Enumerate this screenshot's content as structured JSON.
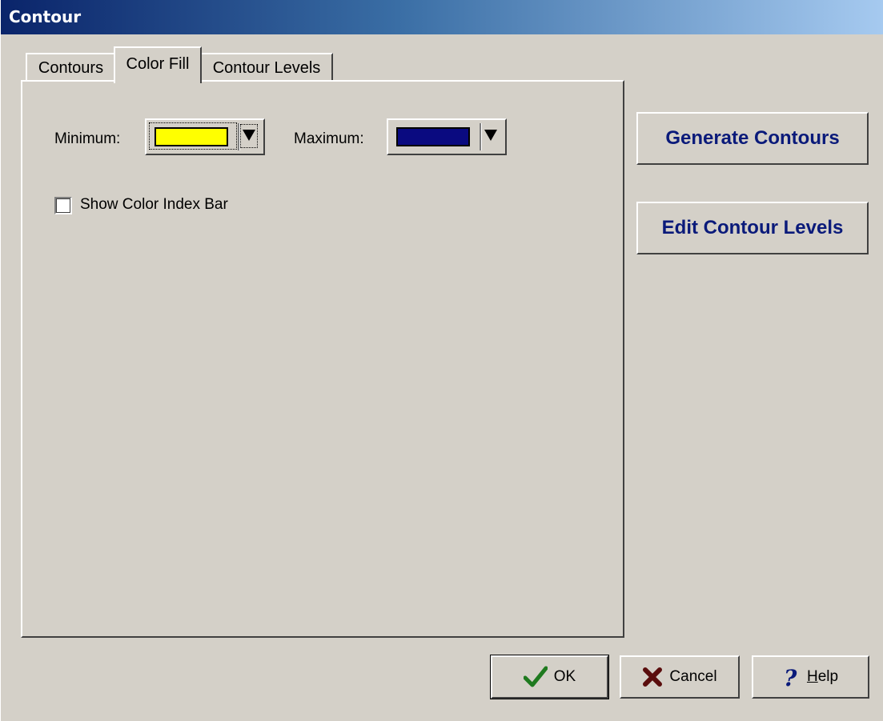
{
  "window": {
    "title": "Contour"
  },
  "tabs": [
    {
      "label": "Contours",
      "active": false
    },
    {
      "label": "Color Fill",
      "active": true
    },
    {
      "label": "Contour Levels",
      "active": false
    }
  ],
  "color_fill": {
    "minimum_label": "Minimum:",
    "minimum_color": "#ffff00",
    "maximum_label": "Maximum:",
    "maximum_color": "#0a0a80",
    "show_index_bar_label": "Show Color Index Bar",
    "show_index_bar_checked": false
  },
  "side_buttons": {
    "generate": "Generate Contours",
    "edit_levels": "Edit Contour Levels"
  },
  "footer": {
    "ok": "OK",
    "cancel": "Cancel",
    "help_prefix": "H",
    "help_rest": "elp"
  },
  "icons": {
    "ok": "check-icon",
    "cancel": "x-icon",
    "help": "question-icon",
    "dropdown": "triangle-down-icon"
  }
}
